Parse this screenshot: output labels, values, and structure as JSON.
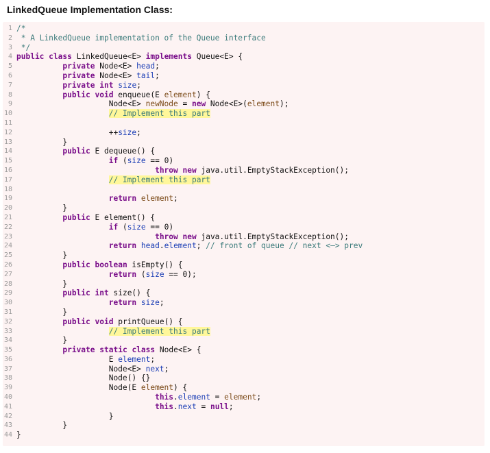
{
  "heading": "LinkedQueue Implementation Class:",
  "code_lines": [
    {
      "n": "1",
      "t": [
        [
          "/*",
          "cm"
        ]
      ]
    },
    {
      "n": "2",
      "t": [
        [
          " * A LinkedQueue implementation of the Queue interface",
          "cm"
        ]
      ]
    },
    {
      "n": "3",
      "t": [
        [
          " */",
          "cm"
        ]
      ]
    },
    {
      "n": "4",
      "t": [
        [
          "public",
          "kw"
        ],
        [
          " "
        ],
        [
          "class",
          "kw"
        ],
        [
          " LinkedQueue<E> "
        ],
        [
          "implements",
          "kw"
        ],
        [
          " Queue<E> {"
        ]
      ]
    },
    {
      "n": "5",
      "t": [
        [
          "          "
        ],
        [
          "private",
          "kw"
        ],
        [
          " Node<E> "
        ],
        [
          "head",
          "fld"
        ],
        [
          ";"
        ]
      ]
    },
    {
      "n": "6",
      "t": [
        [
          "          "
        ],
        [
          "private",
          "kw"
        ],
        [
          " Node<E> "
        ],
        [
          "tail",
          "fld"
        ],
        [
          ";"
        ]
      ]
    },
    {
      "n": "7",
      "t": [
        [
          "          "
        ],
        [
          "private",
          "kw"
        ],
        [
          " "
        ],
        [
          "int",
          "kw"
        ],
        [
          " "
        ],
        [
          "size",
          "fld"
        ],
        [
          ";"
        ]
      ]
    },
    {
      "n": "8",
      "t": [
        [
          "          "
        ],
        [
          "public",
          "kw"
        ],
        [
          " "
        ],
        [
          "void",
          "kw"
        ],
        [
          " enqueue(E "
        ],
        [
          "element",
          "prm"
        ],
        [
          ") {"
        ]
      ]
    },
    {
      "n": "9",
      "t": [
        [
          "                    Node<E> "
        ],
        [
          "newNode",
          "prm"
        ],
        [
          " = "
        ],
        [
          "new",
          "kw"
        ],
        [
          " Node<E>("
        ],
        [
          "element",
          "prm"
        ],
        [
          ");"
        ]
      ]
    },
    {
      "n": "10",
      "t": [
        [
          "                    "
        ],
        [
          "// Implement this part",
          "cm hl"
        ]
      ]
    },
    {
      "n": "11",
      "t": []
    },
    {
      "n": "12",
      "t": [
        [
          "                    ++"
        ],
        [
          "size",
          "fld"
        ],
        [
          ";"
        ]
      ]
    },
    {
      "n": "13",
      "t": [
        [
          "          }"
        ]
      ]
    },
    {
      "n": "14",
      "t": [
        [
          "          "
        ],
        [
          "public",
          "kw"
        ],
        [
          " E dequeue() {"
        ]
      ]
    },
    {
      "n": "15",
      "t": [
        [
          "                    "
        ],
        [
          "if",
          "kw"
        ],
        [
          " ("
        ],
        [
          "size",
          "fld"
        ],
        [
          " == 0)"
        ]
      ]
    },
    {
      "n": "16",
      "t": [
        [
          "                              "
        ],
        [
          "throw",
          "kw"
        ],
        [
          " "
        ],
        [
          "new",
          "kw"
        ],
        [
          " java.util.EmptyStackException();"
        ]
      ]
    },
    {
      "n": "17",
      "t": [
        [
          "                    "
        ],
        [
          "// Implement this part",
          "cm hl"
        ]
      ]
    },
    {
      "n": "18",
      "t": []
    },
    {
      "n": "19",
      "t": [
        [
          "                    "
        ],
        [
          "return",
          "kw"
        ],
        [
          " "
        ],
        [
          "element",
          "prm"
        ],
        [
          ";"
        ]
      ]
    },
    {
      "n": "20",
      "t": [
        [
          "          }"
        ]
      ]
    },
    {
      "n": "21",
      "t": [
        [
          "          "
        ],
        [
          "public",
          "kw"
        ],
        [
          " E element() {"
        ]
      ]
    },
    {
      "n": "22",
      "t": [
        [
          "                    "
        ],
        [
          "if",
          "kw"
        ],
        [
          " ("
        ],
        [
          "size",
          "fld"
        ],
        [
          " == 0)"
        ]
      ]
    },
    {
      "n": "23",
      "t": [
        [
          "                              "
        ],
        [
          "throw",
          "kw"
        ],
        [
          " "
        ],
        [
          "new",
          "kw"
        ],
        [
          " java.util.EmptyStackException();"
        ]
      ]
    },
    {
      "n": "24",
      "t": [
        [
          "                    "
        ],
        [
          "return",
          "kw"
        ],
        [
          " "
        ],
        [
          "head",
          "fld"
        ],
        [
          "."
        ],
        [
          "element",
          "fld"
        ],
        [
          "; "
        ],
        [
          "// front of queue // next <—> prev",
          "cm"
        ]
      ]
    },
    {
      "n": "25",
      "t": [
        [
          "          }"
        ]
      ]
    },
    {
      "n": "26",
      "t": [
        [
          "          "
        ],
        [
          "public",
          "kw"
        ],
        [
          " "
        ],
        [
          "boolean",
          "kw"
        ],
        [
          " isEmpty() {"
        ]
      ]
    },
    {
      "n": "27",
      "t": [
        [
          "                    "
        ],
        [
          "return",
          "kw"
        ],
        [
          " ("
        ],
        [
          "size",
          "fld"
        ],
        [
          " == 0);"
        ]
      ]
    },
    {
      "n": "28",
      "t": [
        [
          "          }"
        ]
      ]
    },
    {
      "n": "29",
      "t": [
        [
          "          "
        ],
        [
          "public",
          "kw"
        ],
        [
          " "
        ],
        [
          "int",
          "kw"
        ],
        [
          " size() {"
        ]
      ]
    },
    {
      "n": "30",
      "t": [
        [
          "                    "
        ],
        [
          "return",
          "kw"
        ],
        [
          " "
        ],
        [
          "size",
          "fld"
        ],
        [
          ";"
        ]
      ]
    },
    {
      "n": "31",
      "t": [
        [
          "          }"
        ]
      ]
    },
    {
      "n": "32",
      "t": [
        [
          "          "
        ],
        [
          "public",
          "kw"
        ],
        [
          " "
        ],
        [
          "void",
          "kw"
        ],
        [
          " printQueue() {"
        ]
      ]
    },
    {
      "n": "33",
      "t": [
        [
          "                    "
        ],
        [
          "// Implement this part",
          "cm hl"
        ]
      ]
    },
    {
      "n": "34",
      "t": [
        [
          "          }"
        ]
      ]
    },
    {
      "n": "35",
      "t": [
        [
          "          "
        ],
        [
          "private",
          "kw"
        ],
        [
          " "
        ],
        [
          "static",
          "kw"
        ],
        [
          " "
        ],
        [
          "class",
          "kw"
        ],
        [
          " Node<E> {"
        ]
      ]
    },
    {
      "n": "36",
      "t": [
        [
          "                    E "
        ],
        [
          "element",
          "fld"
        ],
        [
          ";"
        ]
      ]
    },
    {
      "n": "37",
      "t": [
        [
          "                    Node<E> "
        ],
        [
          "next",
          "fld"
        ],
        [
          ";"
        ]
      ]
    },
    {
      "n": "38",
      "t": [
        [
          "                    Node() {}"
        ]
      ]
    },
    {
      "n": "39",
      "t": [
        [
          "                    Node(E "
        ],
        [
          "element",
          "prm"
        ],
        [
          ") {"
        ]
      ]
    },
    {
      "n": "40",
      "t": [
        [
          "                              "
        ],
        [
          "this",
          "kw"
        ],
        [
          "."
        ],
        [
          "element",
          "fld"
        ],
        [
          " = "
        ],
        [
          "element",
          "prm"
        ],
        [
          ";"
        ]
      ]
    },
    {
      "n": "41",
      "t": [
        [
          "                              "
        ],
        [
          "this",
          "kw"
        ],
        [
          "."
        ],
        [
          "next",
          "fld"
        ],
        [
          " = "
        ],
        [
          "null",
          "kw"
        ],
        [
          ";"
        ]
      ]
    },
    {
      "n": "42",
      "t": [
        [
          "                    }"
        ]
      ]
    },
    {
      "n": "43",
      "t": [
        [
          "          }"
        ]
      ]
    },
    {
      "n": "44",
      "t": [
        [
          "}"
        ]
      ]
    }
  ]
}
